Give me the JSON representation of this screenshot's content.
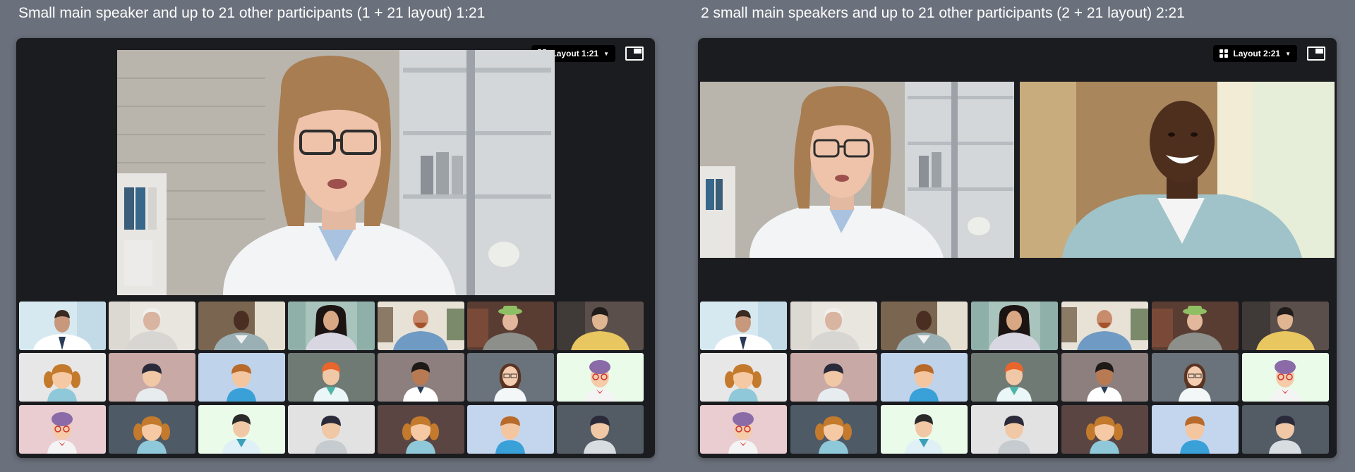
{
  "captions": {
    "left": "Small main speaker and up to 21 other participants (1 + 21 layout) 1:21",
    "right": "2 small main speakers and up to 21 other participants (2 + 21 layout) 2:21"
  },
  "panels": [
    {
      "layout_label": "Layout 1:21"
    },
    {
      "layout_label": "Layout 2:21"
    }
  ],
  "icons": {
    "layout": "grid-icon",
    "dropdown": "caret-down-icon",
    "view": "picture-in-picture-icon"
  },
  "colors": {
    "page_bg": "#6b717c",
    "panel_bg": "#1b1c1f",
    "avatar_tile_bgs": [
      "#e7e7e7",
      "#c8a9a6",
      "#bfd3ea",
      "#707a74",
      "#8c7f7d",
      "#6a737b",
      "#eafbea",
      "#e9cdd0",
      "#4e5a66",
      "#eafbea",
      "#e2e2e2",
      "#5a4543",
      "#c4d6ee",
      "#535c65"
    ]
  },
  "participants": {
    "photo_row": [
      "doctor-man",
      "elderly-woman",
      "smiling-man",
      "young-woman",
      "bearded-man",
      "man-green-hat",
      "young-man"
    ],
    "avatar_rows": [
      [
        "girl-pigtails",
        "boy",
        "boy-blue",
        "doctor-redhead",
        "doctor-dark",
        "woman-glasses",
        "grandma"
      ],
      [
        "grandma",
        "girl-pigtails",
        "doctor-faceless",
        "man",
        "girl-pigtails",
        "boy-blue",
        "boy"
      ]
    ]
  }
}
